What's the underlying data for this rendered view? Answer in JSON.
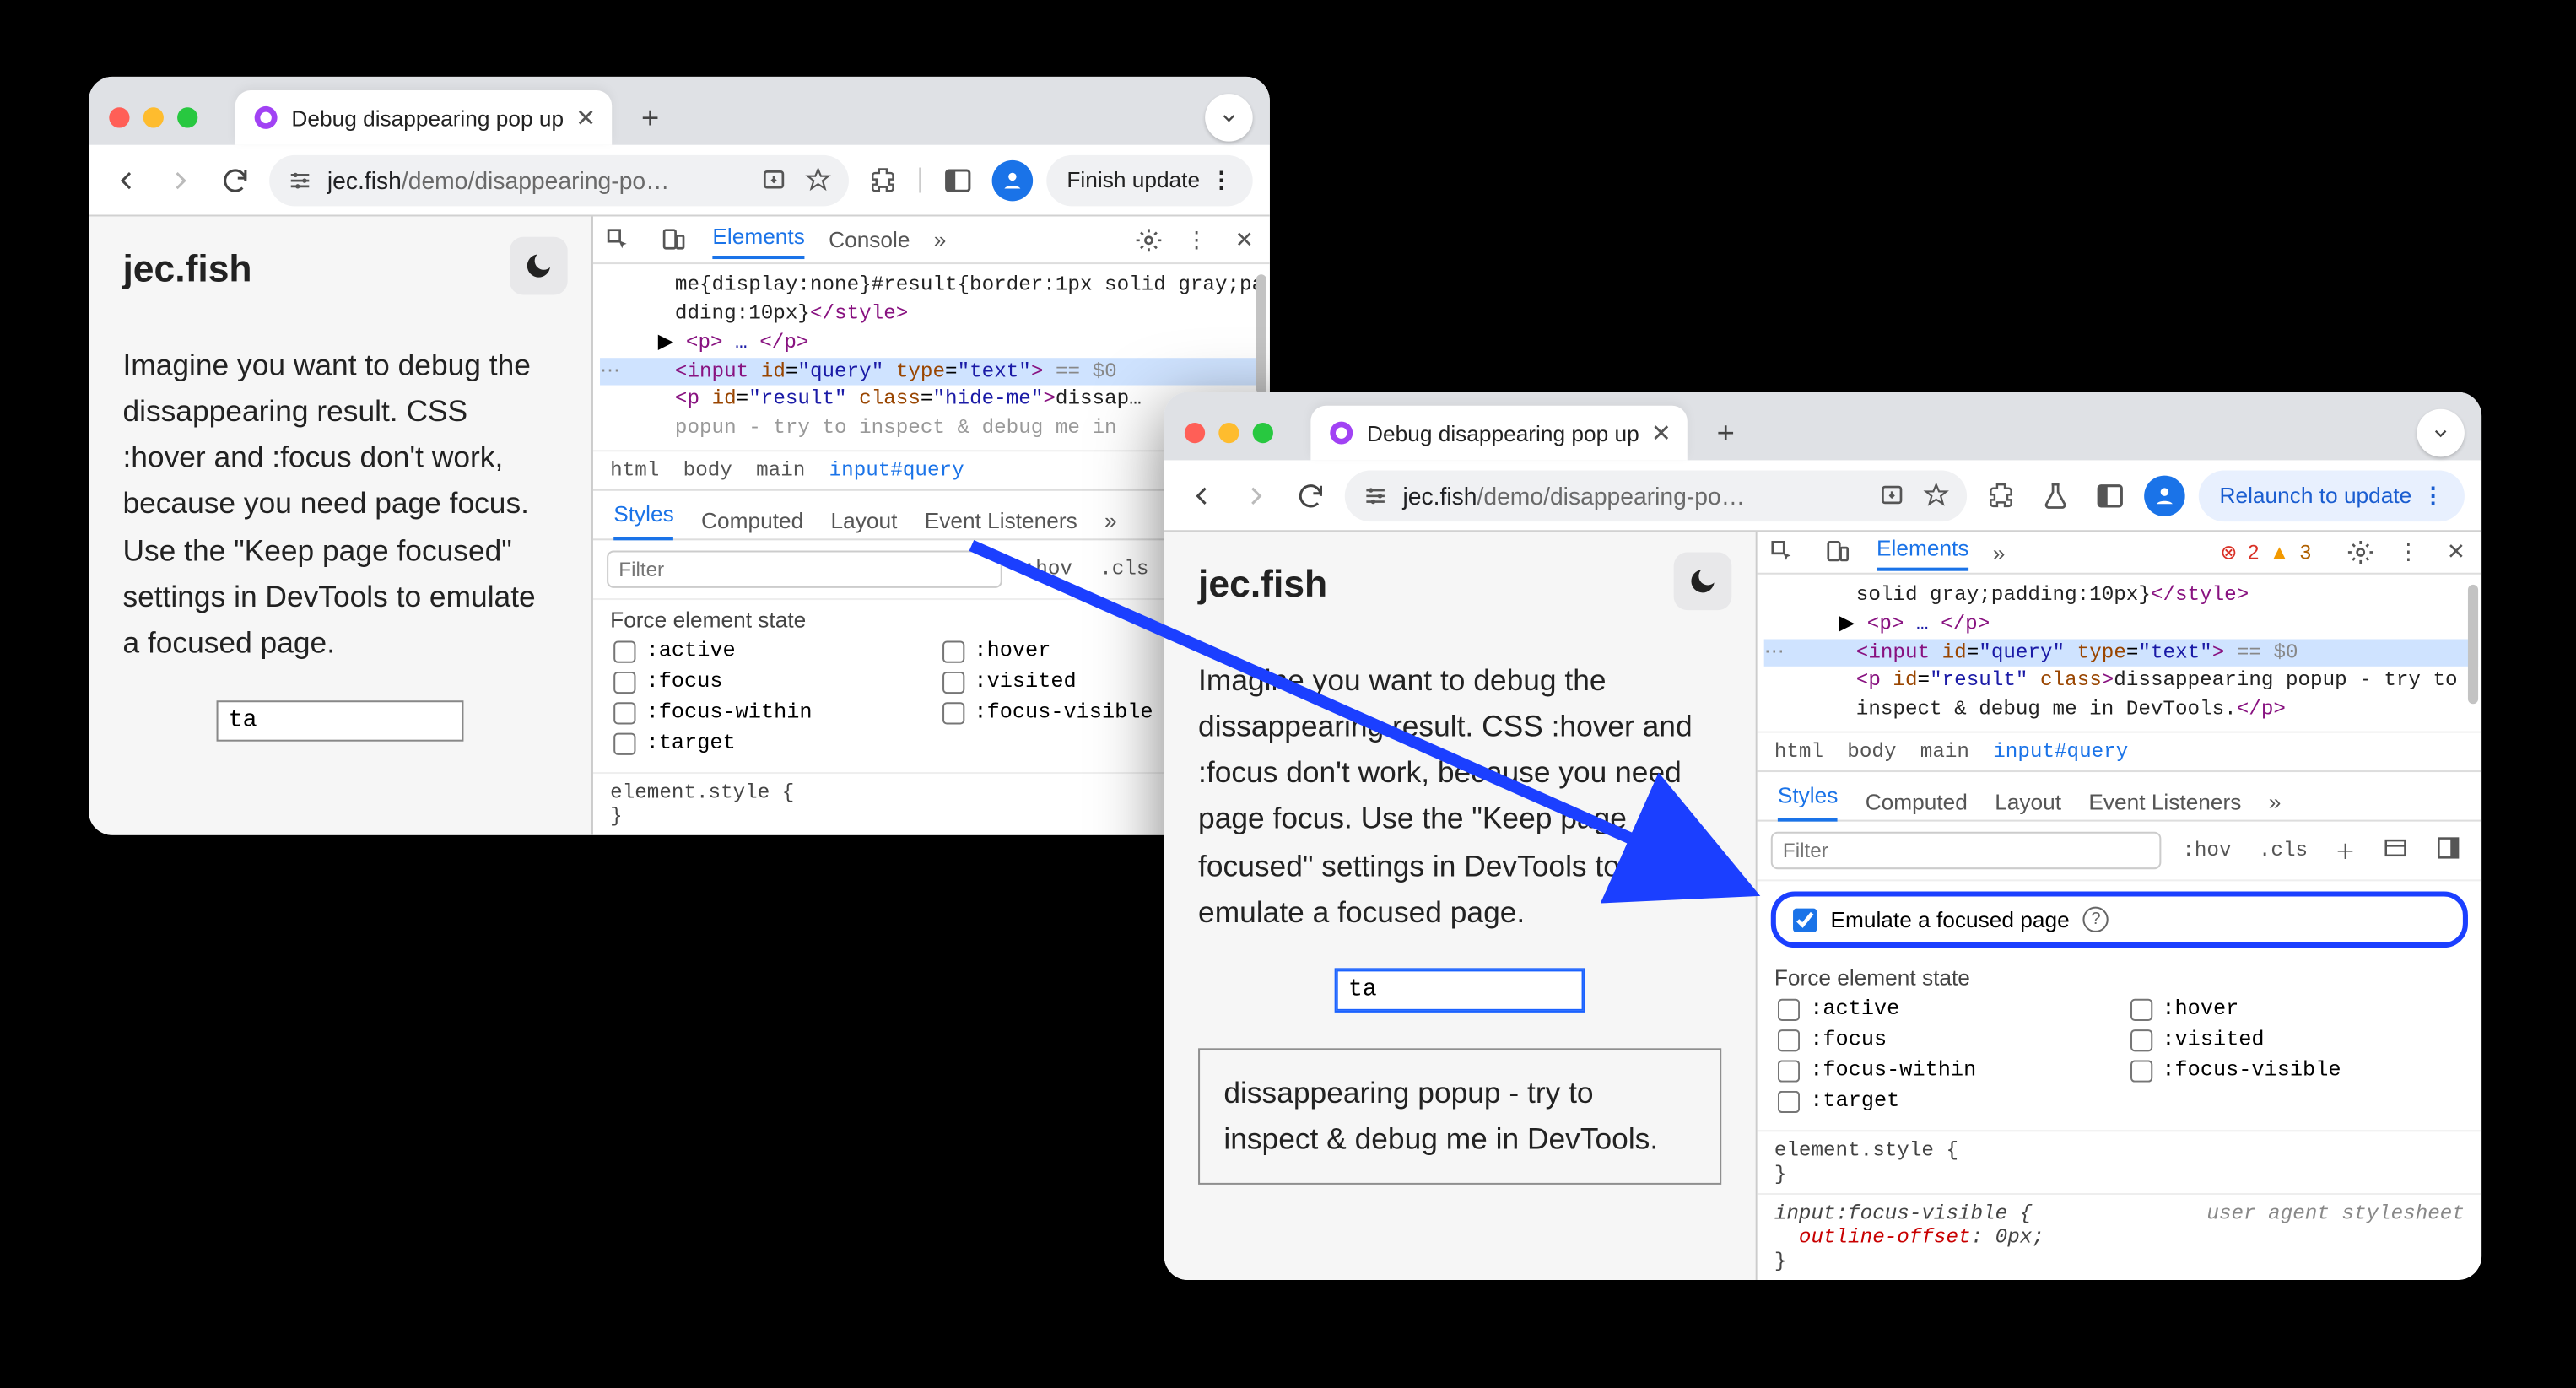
{
  "w1": {
    "tab_title": "Debug disappearing pop up",
    "url_host": "jec.fish",
    "url_path": "/demo/disappearing-po…",
    "update_btn": "Finish update",
    "page": {
      "site": "jec.fish",
      "body": "Imagine you want to debug the dissappearing result. CSS :hover and :focus don't work, because you need page focus. Use the \"Keep page focused\" settings in DevTools to emulate a focused page.",
      "input_value": "ta"
    },
    "devtools": {
      "tabs": {
        "elements": "Elements",
        "console": "Console"
      },
      "dom": {
        "style_wrap": "me{display:none}#result{border:1px solid gray;padding:10px}",
        "style_close": "</style>",
        "p_open": "<p>",
        "p_ell": "…",
        "p_close": "</p>",
        "input_line": "<input id=\"query\" type=\"text\">",
        "eq0": " == $0",
        "result_open": "<p id=\"result\" class=\"hide-me\">",
        "result_text": "dissap…",
        "cut": "popun - try to inspect & debug me in"
      },
      "crumbs": [
        "html",
        "body",
        "main",
        "input#query"
      ],
      "styles_tabs": {
        "styles": "Styles",
        "computed": "Computed",
        "layout": "Layout",
        "ev": "Event Listeners"
      },
      "filter_placeholder": "Filter",
      "hov": ":hov",
      "cls": ".cls",
      "force_label": "Force element state",
      "states": [
        ":active",
        ":hover",
        ":focus",
        ":visited",
        ":focus-within",
        ":focus-visible",
        ":target"
      ],
      "el_style": "element.style {\n}"
    }
  },
  "w2": {
    "tab_title": "Debug disappearing pop up",
    "url_host": "jec.fish",
    "url_path": "/demo/disappearing-po…",
    "update_btn": "Relaunch to update",
    "errors": "2",
    "warnings": "3",
    "page": {
      "site": "jec.fish",
      "body": "Imagine you want to debug the dissappearing result. CSS :hover and :focus don't work, because you need page focus. Use the \"Keep page focused\" settings in DevTools to emulate a focused page.",
      "input_value": "ta",
      "popup": "dissappearing popup - try to inspect & debug me in DevTools."
    },
    "devtools": {
      "tabs": {
        "elements": "Elements"
      },
      "dom": {
        "style_wrap": "solid gray;padding:10px}",
        "style_close": "</style>",
        "p_open": "<p>",
        "p_ell": "…",
        "p_close": "</p>",
        "input_line": "<input id=\"query\" type=\"text\">",
        "eq0": " == $0",
        "result_full": "<p id=\"result\" class>dissappearing popup - try to inspect & debug me in DevTools.</p>"
      },
      "crumbs": [
        "html",
        "body",
        "main",
        "input#query"
      ],
      "styles_tabs": {
        "styles": "Styles",
        "computed": "Computed",
        "layout": "Layout",
        "ev": "Event Listeners"
      },
      "filter_placeholder": "Filter",
      "hov": ":hov",
      "cls": ".cls",
      "emulate_label": "Emulate a focused page",
      "force_label": "Force element state",
      "states": [
        ":active",
        ":hover",
        ":focus",
        ":visited",
        ":focus-within",
        ":focus-visible",
        ":target"
      ],
      "el_style": "element.style {\n}",
      "focus_rule_sel": "input:focus-visible {",
      "focus_rule_prop": "outline-offset",
      "focus_rule_val": ": 0px;",
      "ua_label": "user agent stylesheet"
    }
  }
}
